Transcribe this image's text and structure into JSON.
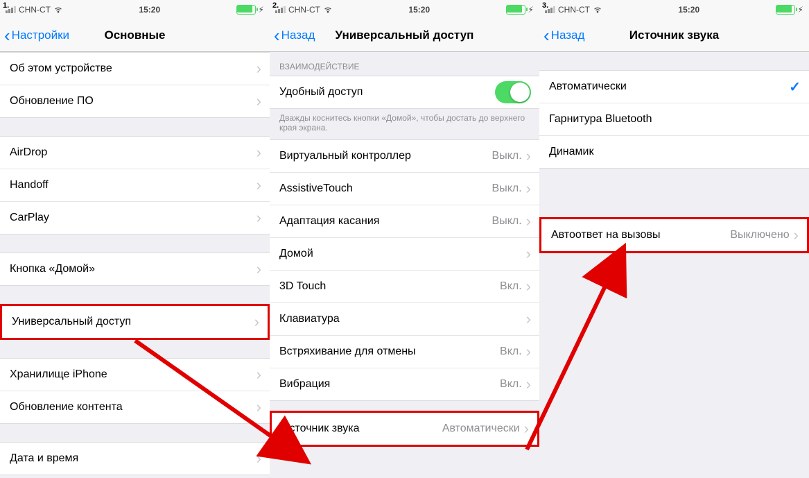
{
  "status": {
    "carrier": "CHN-CT",
    "time": "15:20"
  },
  "s1": {
    "step": "1.",
    "back": "Настройки",
    "title": "Основные",
    "g1": [
      {
        "label": "Об этом устройстве"
      },
      {
        "label": "Обновление ПО"
      }
    ],
    "g2": [
      {
        "label": "AirDrop"
      },
      {
        "label": "Handoff"
      },
      {
        "label": "CarPlay"
      }
    ],
    "g3": [
      {
        "label": "Кнопка «Домой»"
      }
    ],
    "g4": [
      {
        "label": "Универсальный доступ"
      }
    ],
    "g5": [
      {
        "label": "Хранилище iPhone"
      },
      {
        "label": "Обновление контента"
      }
    ],
    "g6": [
      {
        "label": "Дата и время"
      }
    ]
  },
  "s2": {
    "step": "2.",
    "back": "Назад",
    "title": "Универсальный доступ",
    "section": "Взаимодействие",
    "easy": {
      "label": "Удобный доступ"
    },
    "footer": "Дважды коснитесь кнопки «Домой», чтобы достать до верхнего края экрана.",
    "items": [
      {
        "label": "Виртуальный контроллер",
        "detail": "Выкл."
      },
      {
        "label": "AssistiveTouch",
        "detail": "Выкл."
      },
      {
        "label": "Адаптация касания",
        "detail": "Выкл."
      },
      {
        "label": "Домой",
        "detail": ""
      },
      {
        "label": "3D Touch",
        "detail": "Вкл."
      },
      {
        "label": "Клавиатура",
        "detail": ""
      },
      {
        "label": "Встряхивание для отмены",
        "detail": "Вкл."
      },
      {
        "label": "Вибрация",
        "detail": "Вкл."
      }
    ],
    "source": {
      "label": "Источник звука",
      "detail": "Автоматически"
    }
  },
  "s3": {
    "step": "3.",
    "back": "Назад",
    "title": "Источник звука",
    "items": [
      {
        "label": "Автоматически",
        "checked": true
      },
      {
        "label": "Гарнитура Bluetooth",
        "checked": false
      },
      {
        "label": "Динамик",
        "checked": false
      }
    ],
    "auto": {
      "label": "Автоответ на вызовы",
      "detail": "Выключено"
    }
  }
}
